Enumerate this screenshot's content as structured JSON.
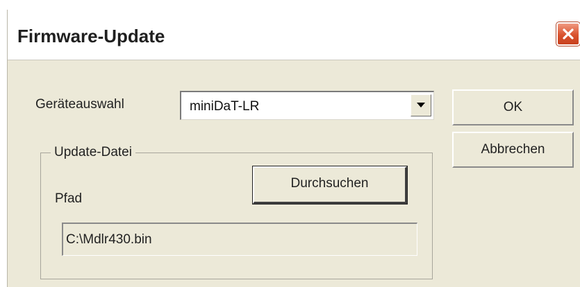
{
  "window": {
    "title": "Firmware-Update"
  },
  "device": {
    "label": "Geräteauswahl",
    "selected": "miniDaT-LR"
  },
  "buttons": {
    "ok": "OK",
    "cancel": "Abbrechen",
    "browse": "Durchsuchen"
  },
  "update_file": {
    "group_title": "Update-Datei",
    "path_label": "Pfad",
    "path_value": "C:\\Mdlr430.bin"
  },
  "icons": {
    "close": "close-icon",
    "dropdown": "chevron-down-icon"
  },
  "colors": {
    "dialog_background": "#ece9d8",
    "close_button": "#d9532f"
  }
}
